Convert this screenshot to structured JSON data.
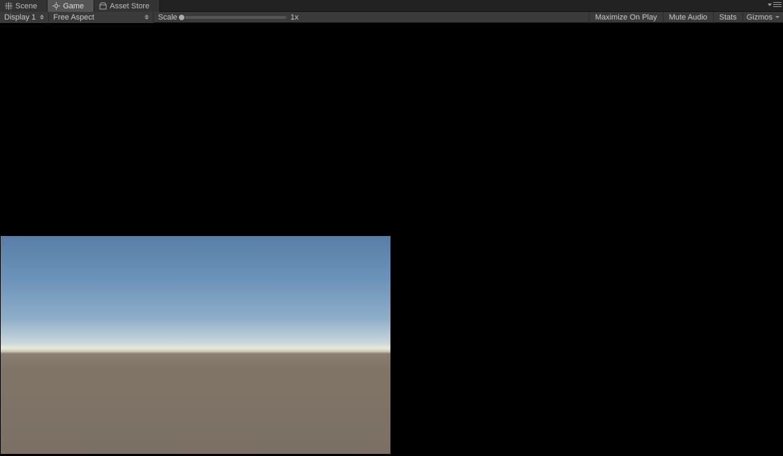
{
  "tabs": {
    "scene": {
      "label": "Scene"
    },
    "game": {
      "label": "Game"
    },
    "asset": {
      "label": "Asset Store"
    }
  },
  "toolbar": {
    "display_label": "Display 1",
    "aspect_label": "Free Aspect",
    "scale_label": "Scale",
    "scale_value": "1x",
    "maximize": "Maximize On Play",
    "mute": "Mute Audio",
    "stats": "Stats",
    "gizmos": "Gizmos"
  }
}
